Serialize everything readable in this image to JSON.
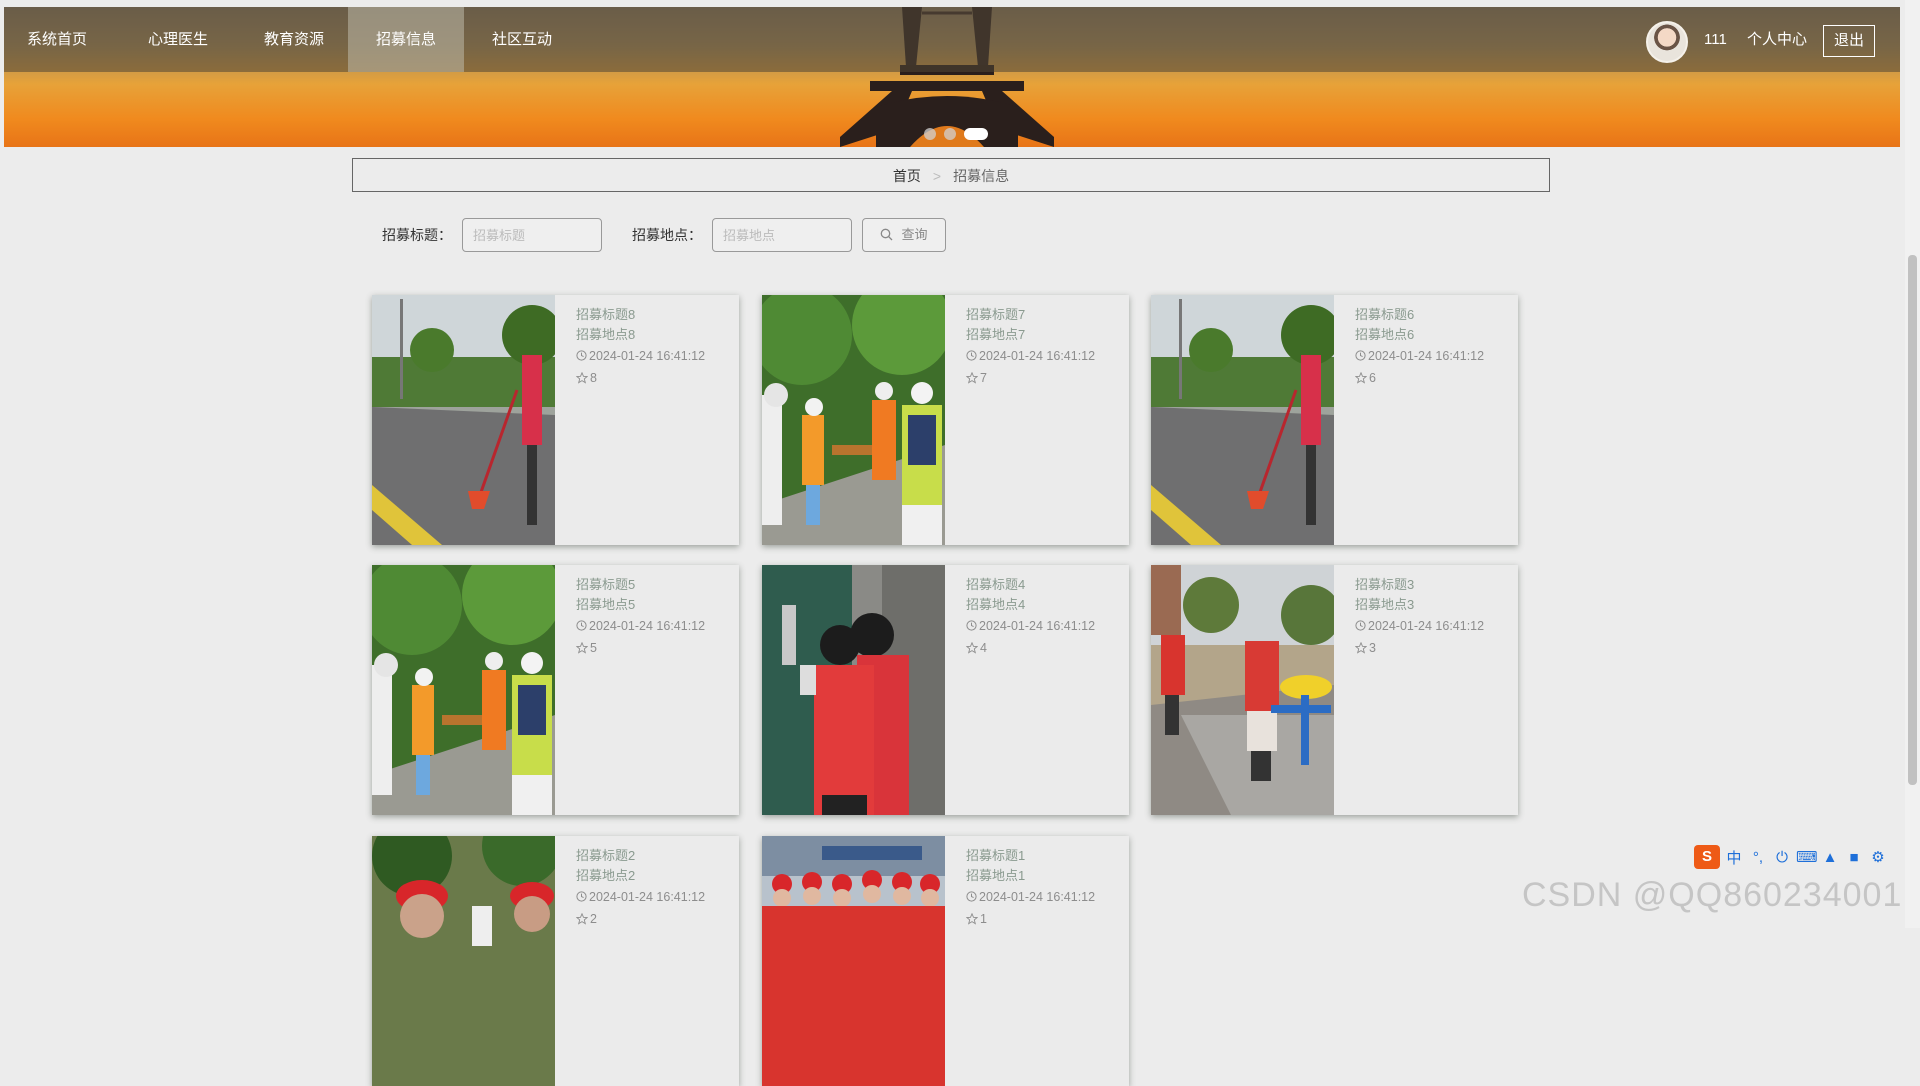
{
  "nav": {
    "items": [
      {
        "label": "系统首页"
      },
      {
        "label": "心理医生"
      },
      {
        "label": "教育资源"
      },
      {
        "label": "招募信息",
        "active": true
      },
      {
        "label": "社区互动"
      }
    ],
    "username": "111",
    "user_center": "个人中心",
    "logout": "退出"
  },
  "carousel": {
    "count": 3,
    "active_index": 2
  },
  "breadcrumb": {
    "home": "首页",
    "separator": ">",
    "current": "招募信息"
  },
  "search": {
    "title_label": "招募标题：",
    "title_placeholder": "招募标题",
    "location_label": "招募地点：",
    "location_placeholder": "招募地点",
    "button_label": "查询"
  },
  "cards": [
    {
      "title": "招募标题8",
      "location": "招募地点8",
      "time": "2024-01-24 16:41:12",
      "stars": "8",
      "image": "volunteer-sweeping-street"
    },
    {
      "title": "招募标题7",
      "location": "招募地点7",
      "time": "2024-01-24 16:41:12",
      "stars": "7",
      "image": "students-picking-litter"
    },
    {
      "title": "招募标题6",
      "location": "招募地点6",
      "time": "2024-01-24 16:41:12",
      "stars": "6",
      "image": "volunteer-sweeping-street"
    },
    {
      "title": "招募标题5",
      "location": "招募地点5",
      "time": "2024-01-24 16:41:12",
      "stars": "5",
      "image": "students-picking-litter"
    },
    {
      "title": "招募标题4",
      "location": "招募地点4",
      "time": "2024-01-24 16:41:12",
      "stars": "4",
      "image": "volunteers-at-door"
    },
    {
      "title": "招募标题3",
      "location": "招募地点3",
      "time": "2024-01-24 16:41:12",
      "stars": "3",
      "image": "volunteers-in-park"
    },
    {
      "title": "招募标题2",
      "location": "招募地点2",
      "time": "2024-01-24 16:41:12",
      "stars": "2",
      "image": "volunteers-red-caps"
    },
    {
      "title": "招募标题1",
      "location": "招募地点1",
      "time": "2024-01-24 16:41:12",
      "stars": "1",
      "image": "volunteer-group-station"
    }
  ],
  "watermark": "CSDN @QQ860234001",
  "ime": {
    "logo": "S",
    "mode": "中"
  }
}
